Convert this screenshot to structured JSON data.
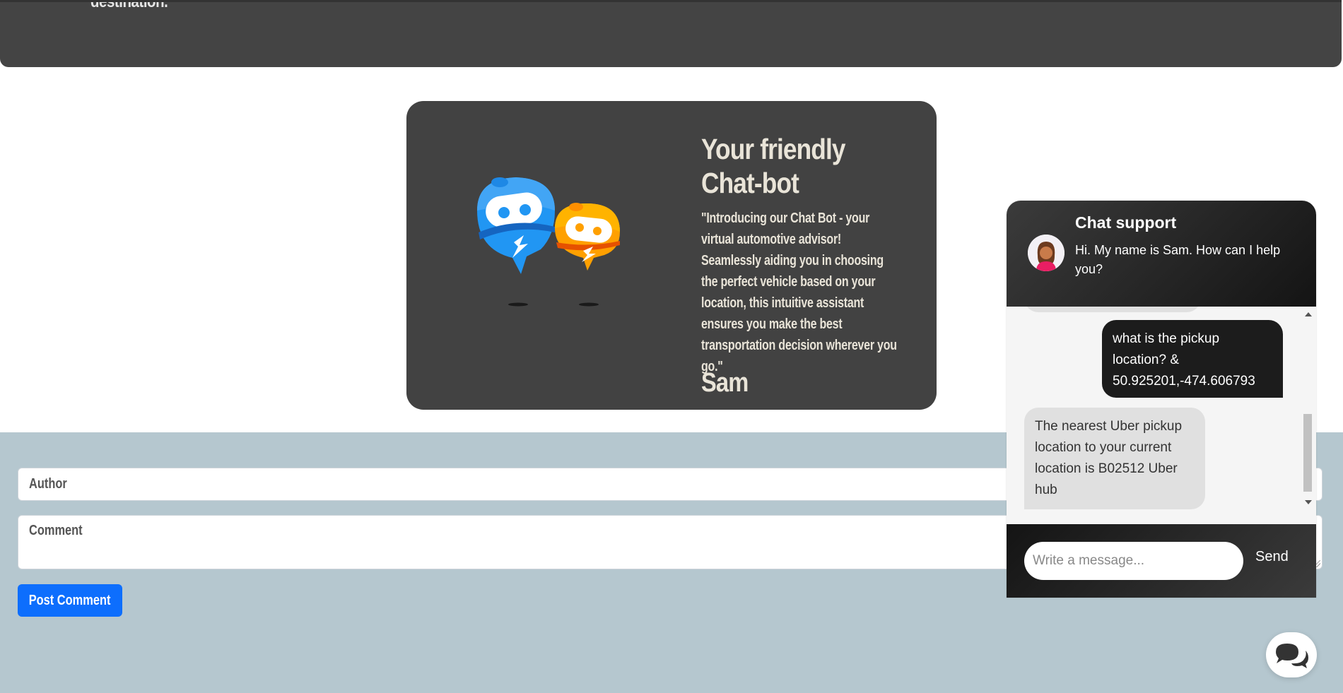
{
  "top_banner": {
    "cut_text": "destination."
  },
  "card": {
    "title": "Your friendly Chat-bot",
    "quote": "\"Introducing our Chat Bot - your virtual automotive advisor! Seamlessly aiding you in choosing the perfect vehicle based on your location, this intuitive assistant ensures you make the best transportation decision wherever you go.\"",
    "name": "Sam",
    "colors": {
      "background": "#424242",
      "text": "#e9e4d8",
      "bot_blue": "#2196f3",
      "bot_orange": "#ffa000"
    }
  },
  "comments": {
    "author_placeholder": "Author",
    "comment_placeholder": "Comment",
    "post_label": "Post Comment",
    "colors": {
      "background": "#b5c7cf",
      "button": "#0d6efd"
    }
  },
  "chat": {
    "title": "Chat support",
    "subtitle": "Hi. My name is Sam. How can I help you?",
    "messages": [
      {
        "from": "user",
        "text": "what is the pickup location? & 50.925201,-474.606793"
      },
      {
        "from": "bot",
        "text": "The nearest Uber pickup location to your current location is B02512 Uber hub"
      }
    ],
    "input_placeholder": "Write a message...",
    "send_label": "Send",
    "launcher_icon": "chat-bubbles-icon",
    "colors": {
      "header_dark": "#141414",
      "user_bubble": "#1c1c1c",
      "bot_bubble": "#e0e0e0"
    }
  }
}
